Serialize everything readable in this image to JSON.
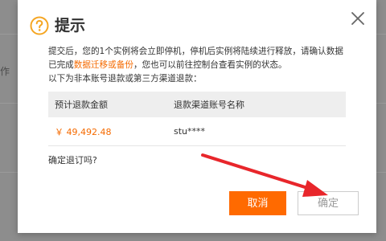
{
  "background": {
    "left_fragment": "作"
  },
  "dialog": {
    "title": "提示",
    "message_part1": "提交后，您的1个实例将会立即停机，停机后实例将陆续进行释放，请确认数据已完成",
    "message_highlight": "数据迁移或备份",
    "message_part2": "，您也可以前往控制台查看实例的状态。",
    "message_line3": "以下为非本账号退款或第三方渠道退款：",
    "table": {
      "headers": [
        "预计退款金额",
        "退款渠道账号名称"
      ],
      "rows": [
        {
          "amount": "￥ 49,492.48",
          "account": "stu****"
        }
      ]
    },
    "confirm_question": "确定退订吗?",
    "cancel_label": "取消",
    "confirm_label": "确定"
  },
  "colors": {
    "accent": "#ff6a00",
    "highlight": "#f56a00",
    "warning_icon": "#f5a623",
    "arrow": "#e8262b"
  },
  "icons": {
    "title_icon": "warning-question-icon",
    "close": "close-icon"
  }
}
